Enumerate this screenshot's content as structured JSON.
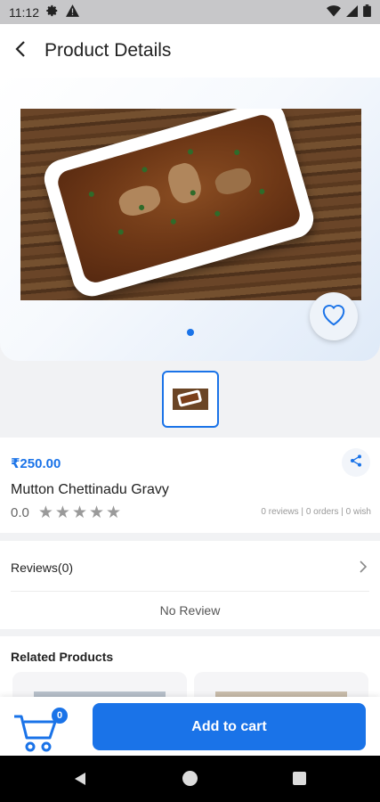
{
  "status_bar": {
    "time": "11:12",
    "left_icons": [
      "gear-icon",
      "warning-icon"
    ],
    "right_icons": [
      "wifi-icon",
      "signal-icon",
      "battery-icon"
    ]
  },
  "app_bar": {
    "back_icon": "chevron-left-icon",
    "title": "Product Details"
  },
  "gallery": {
    "image_description_icon": "food-photo",
    "favorite_icon": "heart-outline-icon",
    "page_count": 1,
    "active_page": 0,
    "thumbnails": 1
  },
  "product": {
    "price": "₹250.00",
    "name": "Mutton Chettinadu Gravy",
    "rating_value": "0.0",
    "stars": [
      "★",
      "★",
      "★",
      "★",
      "★"
    ],
    "stats": "0 reviews | 0 orders | 0 wish",
    "share_icon": "share-icon"
  },
  "reviews": {
    "header": "Reviews(0)",
    "empty_text": "No Review",
    "chevron_icon": "chevron-right-icon"
  },
  "related": {
    "title": "Related Products"
  },
  "bottom_bar": {
    "cart_icon": "cart-icon",
    "cart_count": "0",
    "add_to_cart_label": "Add to cart"
  },
  "colors": {
    "accent": "#1a73e8",
    "star_inactive": "#9a9a9a"
  }
}
